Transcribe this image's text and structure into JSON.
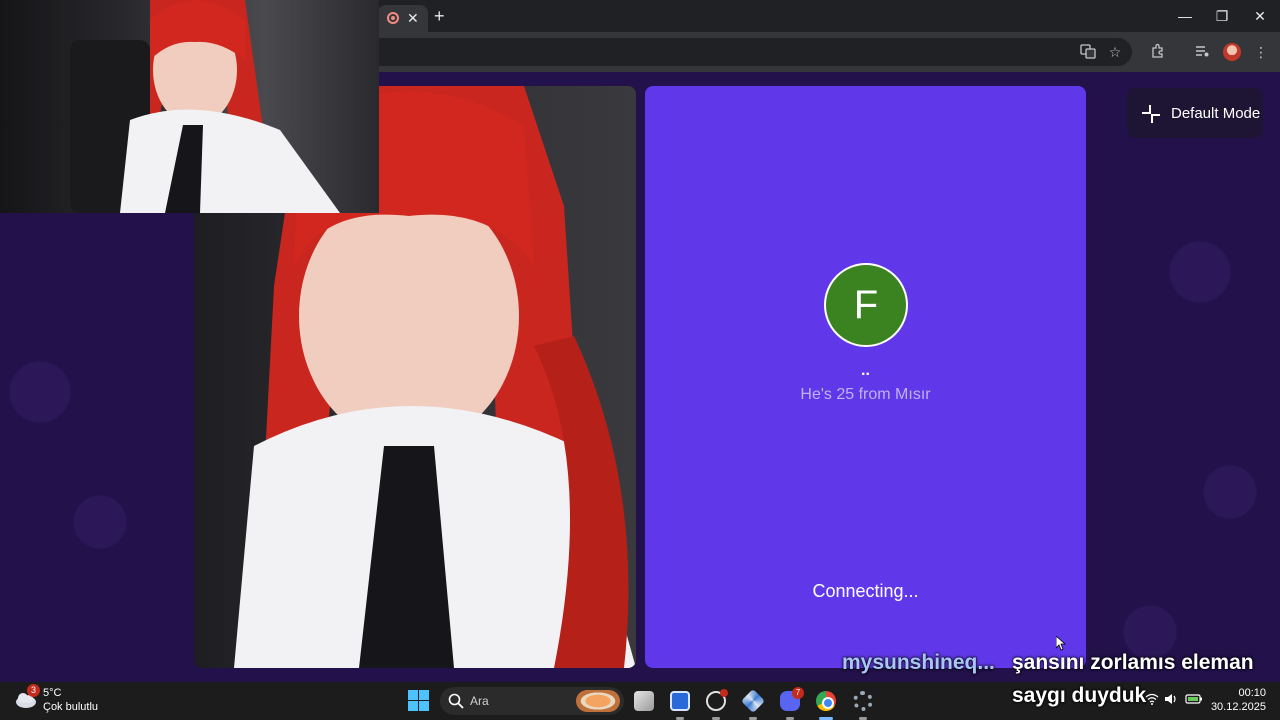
{
  "browser": {
    "tab": {
      "close_glyph": "✕"
    },
    "new_tab_glyph": "+",
    "window_controls": {
      "minimize": "—",
      "restore": "❐",
      "close": "✕"
    },
    "toolbar_icons": [
      "translate-icon",
      "bookmark-star-icon",
      "extensions-icon",
      "media-controls-icon",
      "profile-avatar",
      "menu-icon"
    ]
  },
  "peer": {
    "avatar_letter": "F",
    "name": "..",
    "info": "He's 25 from Mısır",
    "status": "Connecting...",
    "colors": {
      "panel": "#6038ea",
      "avatar": "#3b8221"
    }
  },
  "mode_button": {
    "label": "Default Mode"
  },
  "chat": {
    "username": "mysunshineq...",
    "message_line1": "şansını zorlamıs eleman",
    "message_line2": "saygı duyduk"
  },
  "taskbar": {
    "weather": {
      "badge": "3",
      "temp": "5°C",
      "desc": "Çok bulutlu"
    },
    "search_placeholder": "Ara",
    "apps": [
      "start-icon",
      "search-icon",
      "task-view-icon",
      "app-icon-blue",
      "app-icon-clock",
      "app-icon-mesh",
      "discord-icon",
      "chrome-icon",
      "settings-icon"
    ],
    "badges": {
      "discord": "7"
    },
    "clock": {
      "time": "00:10",
      "date": "30.12.2025"
    }
  }
}
